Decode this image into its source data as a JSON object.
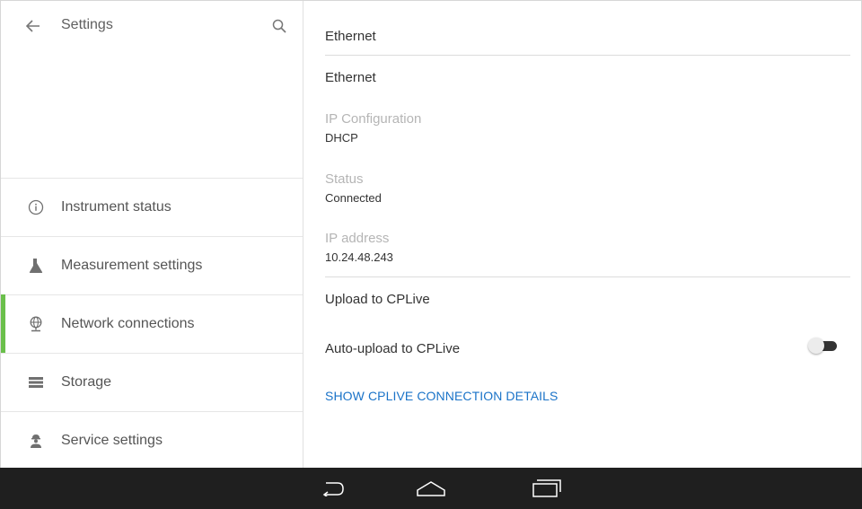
{
  "left": {
    "title": "Settings",
    "nav": [
      {
        "label": "Instrument status",
        "icon": "info-icon",
        "active": false
      },
      {
        "label": "Measurement settings",
        "icon": "flask-icon",
        "active": false
      },
      {
        "label": "Network connections",
        "icon": "globe-icon",
        "active": true
      },
      {
        "label": "Storage",
        "icon": "storage-icon",
        "active": false
      },
      {
        "label": "Service settings",
        "icon": "service-person-icon",
        "active": false
      }
    ]
  },
  "right": {
    "header": "Ethernet",
    "subheader": "Ethernet",
    "fields": [
      {
        "label": "IP Configuration",
        "value": "DHCP"
      },
      {
        "label": "Status",
        "value": "Connected"
      },
      {
        "label": "IP address",
        "value": "10.24.48.243"
      }
    ],
    "upload_section": "Upload to CPLive",
    "auto_upload_label": "Auto-upload to CPLive",
    "auto_upload_on": false,
    "details_link": "SHOW CPLIVE CONNECTION DETAILS"
  },
  "colors": {
    "accent": "#6abf4b",
    "link": "#1a73c8",
    "system_bar": "#1f1f1f"
  }
}
